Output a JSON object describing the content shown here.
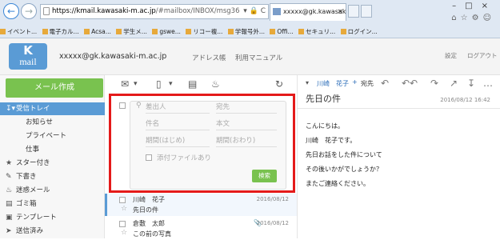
{
  "browser": {
    "url_host": "https://kmail.kawasaki-m.ac.jp",
    "url_rest": "/#mailbox/INBOX/msg36",
    "tab_title": "xxxxx@gk.kawasaki-m.ac.jp",
    "favorites": [
      "イベント...",
      "電子カル...",
      "Acsa...",
      "学生メ...",
      "gswe...",
      "リコー複...",
      "学報号外...",
      "Offi...",
      "セキュリ...",
      "ログイン..."
    ]
  },
  "header": {
    "logo_k": "K",
    "logo_mail": "mail",
    "user_email": "xxxxx@gk.kawasaki-m.ac.jp",
    "address_book": "アドレス帳",
    "manual": "利用マニュアル",
    "settings": "設定",
    "logout": "ログアウト"
  },
  "sidebar": {
    "compose": "メール作成",
    "folders": [
      {
        "label": "受信トレイ",
        "icon": "inbox-icon"
      },
      {
        "label": "お知らせ"
      },
      {
        "label": "プライベート"
      },
      {
        "label": "仕事"
      },
      {
        "label": "スター付き",
        "icon": "star-icon"
      },
      {
        "label": "下書き",
        "icon": "draft-icon"
      },
      {
        "label": "迷惑メール",
        "icon": "flame-icon"
      },
      {
        "label": "ゴミ箱",
        "icon": "trash-icon"
      },
      {
        "label": "テンプレート",
        "icon": "template-icon"
      },
      {
        "label": "送信済み",
        "icon": "sent-icon"
      }
    ]
  },
  "search": {
    "sender": "差出人",
    "recipient": "宛先",
    "subject": "件名",
    "body": "本文",
    "date_from": "期間(はじめ)",
    "date_to": "期間(おわり)",
    "has_attachment": "添付ファイルあり",
    "button": "検索"
  },
  "messages": [
    {
      "sender": "川崎　花子",
      "date": "2016/08/12",
      "subject": "先日の件"
    },
    {
      "sender": "倉敷　太郎",
      "date": "2016/08/12",
      "subject": "この前の写真"
    }
  ],
  "reading": {
    "from_name": "川崎　花子",
    "from_plus": "+",
    "from_role": "宛先",
    "subject": "先日の件",
    "date": "2016/08/12 16:42",
    "body": [
      "こんにちは。",
      "川崎　花子です。",
      "先日お話をした件について",
      "その後いかがでしょうか？",
      "またご連絡ください。"
    ]
  }
}
